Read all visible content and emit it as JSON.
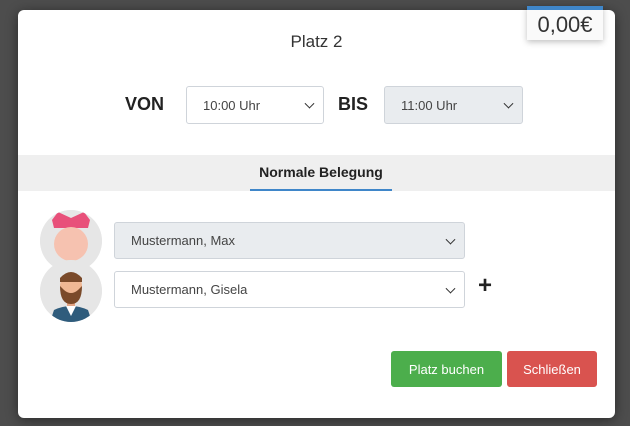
{
  "price": "0,00€",
  "title": "Platz 2",
  "time": {
    "from_label": "VON",
    "from_value": "10:00 Uhr",
    "to_label": "BIS",
    "to_value": "11:00 Uhr"
  },
  "tab": {
    "label": "Normale Belegung"
  },
  "players": [
    {
      "name": "Mustermann, Max"
    },
    {
      "name": "Mustermann, Gisela"
    }
  ],
  "plus": "+",
  "buttons": {
    "book": "Platz buchen",
    "close": "Schließen"
  },
  "colors": {
    "accent": "#3f86c9",
    "book": "#4cae4c",
    "close": "#d9534f"
  }
}
